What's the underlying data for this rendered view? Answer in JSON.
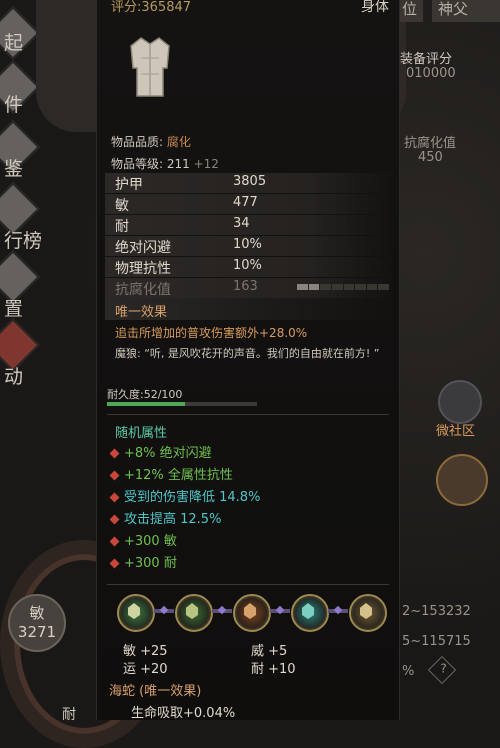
{
  "left_menu": [
    {
      "label": "兑起",
      "icon": "compass-icon"
    },
    {
      "label": "邮件",
      "icon": "mail-icon"
    },
    {
      "label": "图鉴",
      "icon": "book-icon"
    },
    {
      "label": "排行榜",
      "icon": "ranking-icon"
    },
    {
      "label": "设置",
      "icon": "gear-icon"
    },
    {
      "label": "活动",
      "icon": "event-icon"
    }
  ],
  "left_menu_visible": [
    "起",
    "件",
    "鉴",
    "行榜",
    "置",
    "动"
  ],
  "right_tabs": [
    "位",
    "神父"
  ],
  "right_info": {
    "equip_score_label": "装备评分",
    "equip_score_value": "010000",
    "corrosion_label": "抗腐化值",
    "corrosion_value": "450",
    "community_label": "微社区",
    "range1": "2~153232",
    "range2": "5~115715",
    "percent_glyph": "%",
    "help_glyph": "?"
  },
  "bottom_left": {
    "stat_label": "敏",
    "stat_value": "3271",
    "bottom_label": "耐"
  },
  "tooltip": {
    "score": "评分:365847",
    "slot": "身体",
    "quality_label": "物品品质: ",
    "quality_value": "腐化",
    "level_label": "物品等级:",
    "level_value": "211",
    "level_bonus": "+12",
    "stats": [
      {
        "name": "护甲",
        "value": "3805"
      },
      {
        "name": "敏",
        "value": "477"
      },
      {
        "name": "耐",
        "value": "34"
      },
      {
        "name": "绝对闪避",
        "value": "10%"
      },
      {
        "name": "物理抗性",
        "value": "10%"
      }
    ],
    "corrosion": {
      "name": "抗腐化值",
      "value": "163",
      "segments_filled": 2,
      "segments_total": 8
    },
    "unique_title": "唯一效果",
    "unique_effect": "追击所增加的普攻伤害额外+28.0%",
    "quote": "魔狼: “听, 是风吹花开的声音。我们的自由就在前方! ”",
    "durability_label": "耐久度:52/100",
    "durability": 0.52,
    "random_title": "随机属性",
    "random_attrs": [
      {
        "text": "+8% 绝对闪避",
        "color": "green"
      },
      {
        "text": "+12% 全属性抗性",
        "color": "green"
      },
      {
        "text": "受到的伤害降低 14.8%",
        "color": "cyan"
      },
      {
        "text": "攻击提高 12.5%",
        "color": "cyan"
      },
      {
        "text": "+300 敏",
        "color": "green"
      },
      {
        "text": "+300 耐",
        "color": "green"
      }
    ],
    "gems": [
      {
        "color": "#3f7a45",
        "core": "#cfd3a2"
      },
      {
        "color": "#3d6a35",
        "core": "#b9c483"
      },
      {
        "color": "#7a4322",
        "core": "#d6a46a"
      },
      {
        "color": "#2f7d76",
        "core": "#7cd0c2"
      },
      {
        "color": "#6d5a35",
        "core": "#d4c189"
      }
    ],
    "gem_bonuses": [
      {
        "text": "敏 +25"
      },
      {
        "text": "威 +5"
      },
      {
        "text": "运 +20"
      },
      {
        "text": "耐 +10"
      }
    ],
    "set_title": "海蛇 (唯一效果)",
    "set_line": "生命吸取+0.04%"
  }
}
